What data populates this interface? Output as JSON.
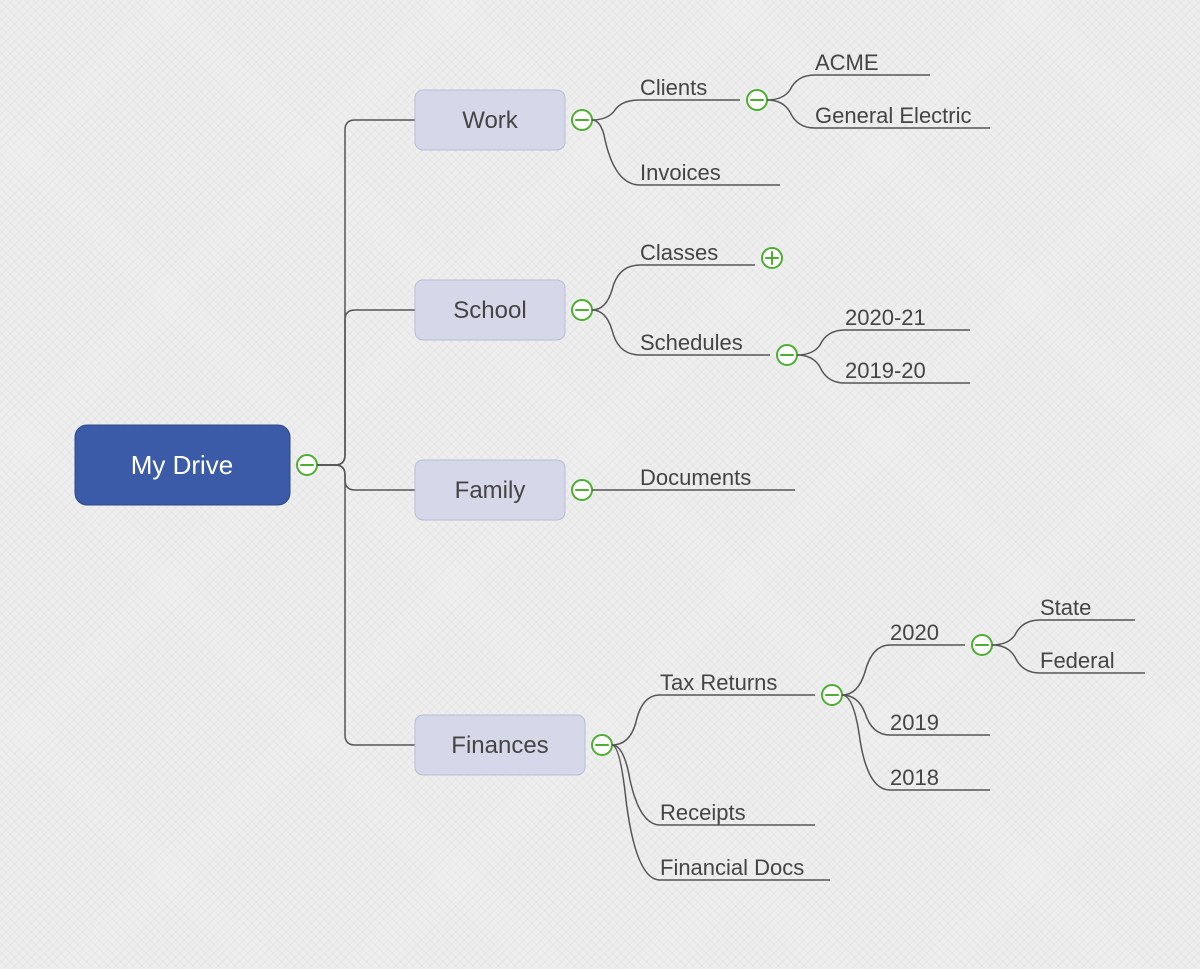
{
  "root": {
    "label": "My Drive",
    "toggle": "minus"
  },
  "categories": [
    {
      "label": "Work",
      "toggle": "minus",
      "children": [
        {
          "label": "Clients",
          "toggle": "minus",
          "children": [
            {
              "label": "ACME"
            },
            {
              "label": "General Electric"
            }
          ]
        },
        {
          "label": "Invoices"
        }
      ]
    },
    {
      "label": "School",
      "toggle": "minus",
      "children": [
        {
          "label": "Classes",
          "toggle": "plus"
        },
        {
          "label": "Schedules",
          "toggle": "minus",
          "children": [
            {
              "label": "2020-21"
            },
            {
              "label": "2019-20"
            }
          ]
        }
      ]
    },
    {
      "label": "Family",
      "toggle": "minus",
      "children": [
        {
          "label": "Documents"
        }
      ]
    },
    {
      "label": "Finances",
      "toggle": "minus",
      "children": [
        {
          "label": "Tax Returns",
          "toggle": "minus",
          "children": [
            {
              "label": "2020",
              "toggle": "minus",
              "children": [
                {
                  "label": "State"
                },
                {
                  "label": "Federal"
                }
              ]
            },
            {
              "label": "2019"
            },
            {
              "label": "2018"
            }
          ]
        },
        {
          "label": "Receipts"
        },
        {
          "label": "Financial Docs"
        }
      ]
    }
  ]
}
